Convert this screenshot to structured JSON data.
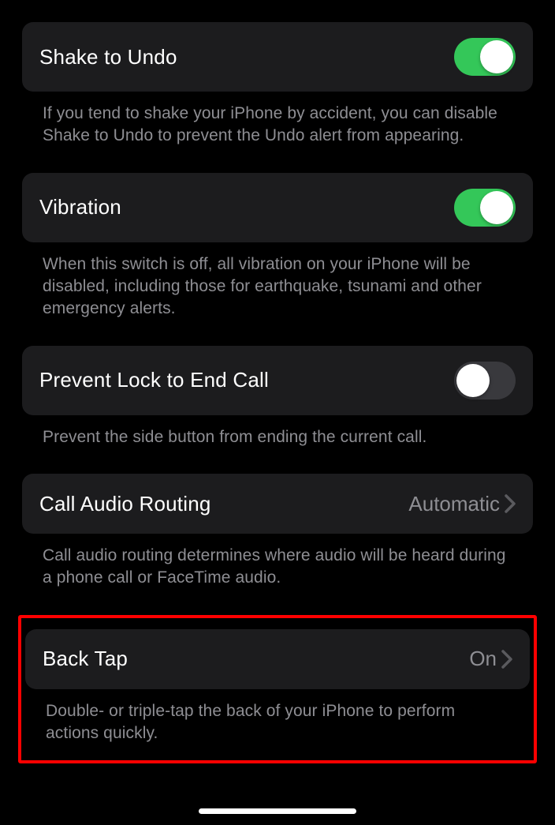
{
  "sections": {
    "shakeToUndo": {
      "label": "Shake to Undo",
      "enabled": true,
      "footer": "If you tend to shake your iPhone by accident, you can disable Shake to Undo to prevent the Undo alert from appearing."
    },
    "vibration": {
      "label": "Vibration",
      "enabled": true,
      "footer": "When this switch is off, all vibration on your iPhone will be disabled, including those for earthquake, tsunami and other emergency alerts."
    },
    "preventLock": {
      "label": "Prevent Lock to End Call",
      "enabled": false,
      "footer": "Prevent the side button from ending the current call."
    },
    "callAudioRouting": {
      "label": "Call Audio Routing",
      "value": "Automatic",
      "footer": "Call audio routing determines where audio will be heard during a phone call or FaceTime audio."
    },
    "backTap": {
      "label": "Back Tap",
      "value": "On",
      "footer": "Double- or triple-tap the back of your iPhone to perform actions quickly."
    }
  }
}
